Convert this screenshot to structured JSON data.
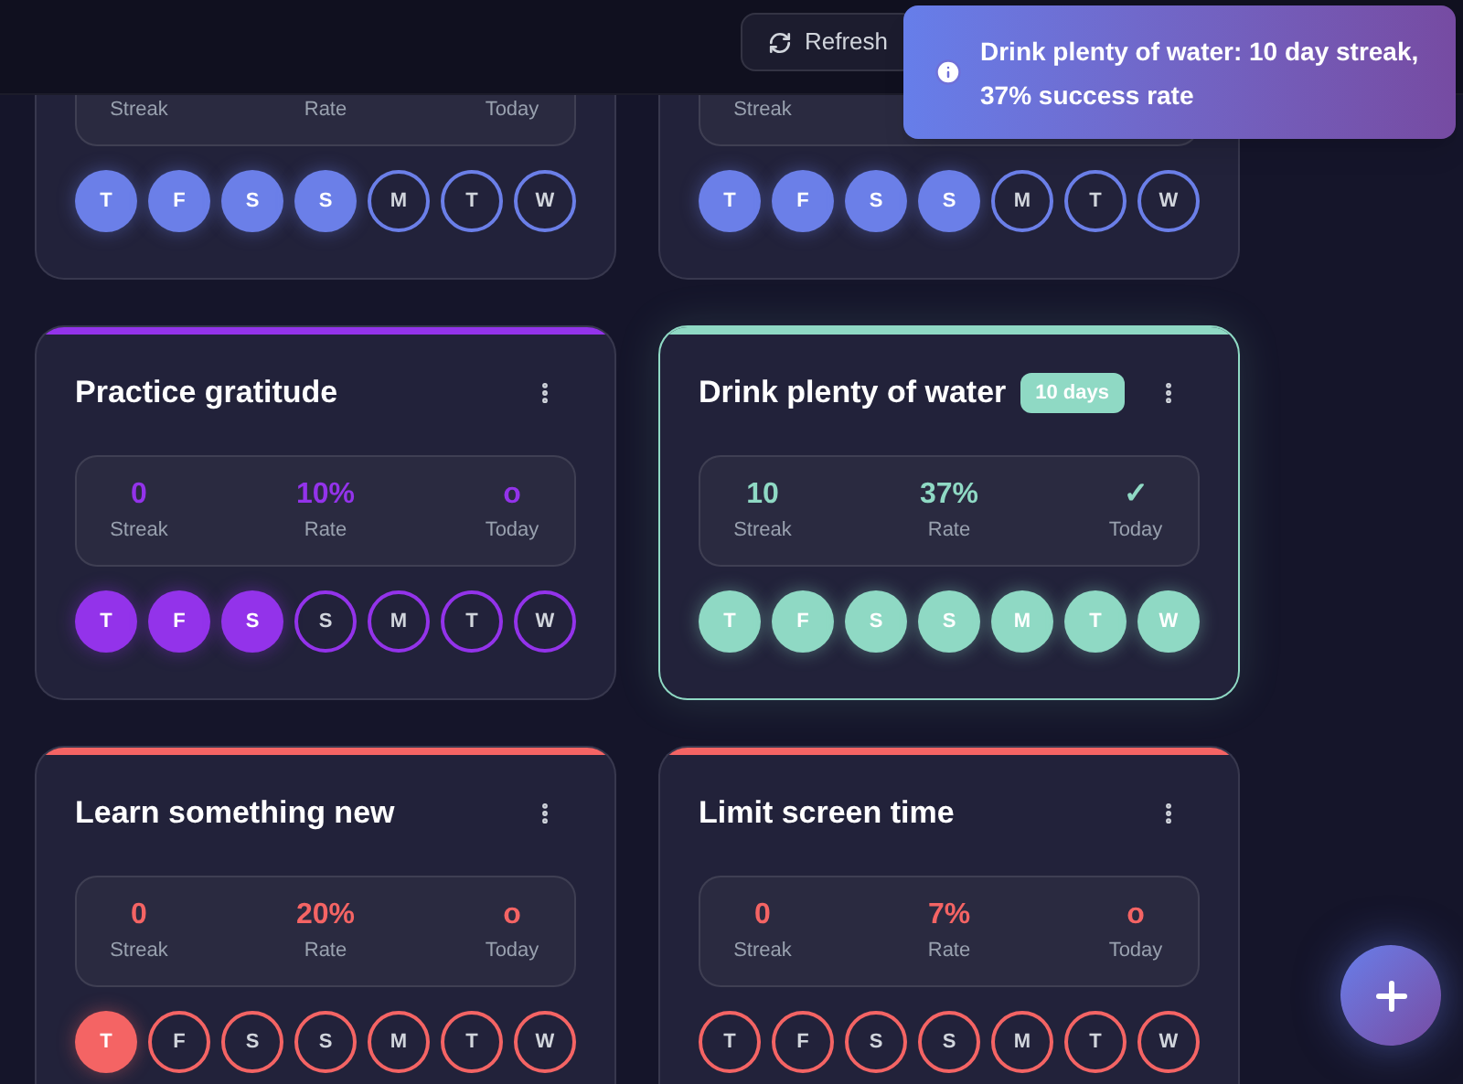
{
  "header": {
    "refresh_button": "Refresh"
  },
  "toast": {
    "message": "Drink plenty of water: 10 day streak, 37% success rate"
  },
  "habits": [
    {
      "color": "#6b7fe8",
      "highlighted": false,
      "stats": [
        {
          "label": "Streak"
        },
        {
          "label": "Rate"
        },
        {
          "label": "Today"
        }
      ],
      "days": [
        {
          "label": "T",
          "done": true
        },
        {
          "label": "F",
          "done": true
        },
        {
          "label": "S",
          "done": true
        },
        {
          "label": "S",
          "done": true
        },
        {
          "label": "M",
          "done": false
        },
        {
          "label": "T",
          "done": false
        },
        {
          "label": "W",
          "done": false
        }
      ]
    },
    {
      "color": "#6b7fe8",
      "highlighted": false,
      "stats": [
        {
          "label": "Streak"
        }
      ],
      "days": [
        {
          "label": "T",
          "done": true
        },
        {
          "label": "F",
          "done": true
        },
        {
          "label": "S",
          "done": true
        },
        {
          "label": "S",
          "done": true
        },
        {
          "label": "M",
          "done": false
        },
        {
          "label": "T",
          "done": false
        },
        {
          "label": "W",
          "done": false
        }
      ]
    },
    {
      "title": "Practice gratitude",
      "color": "#9333ea",
      "highlighted": false,
      "stats": [
        {
          "value": "0",
          "label": "Streak"
        },
        {
          "value": "10%",
          "label": "Rate"
        },
        {
          "value": "o",
          "label": "Today"
        }
      ],
      "days": [
        {
          "label": "T",
          "done": true
        },
        {
          "label": "F",
          "done": true
        },
        {
          "label": "S",
          "done": true
        },
        {
          "label": "S",
          "done": false
        },
        {
          "label": "M",
          "done": false
        },
        {
          "label": "T",
          "done": false
        },
        {
          "label": "W",
          "done": false
        }
      ]
    },
    {
      "title": "Drink plenty of water",
      "badge": "10 days",
      "color": "#8fd9c4",
      "highlighted": true,
      "stats": [
        {
          "value": "10",
          "label": "Streak"
        },
        {
          "value": "37%",
          "label": "Rate"
        },
        {
          "value": "✓",
          "label": "Today"
        }
      ],
      "days": [
        {
          "label": "T",
          "done": true
        },
        {
          "label": "F",
          "done": true
        },
        {
          "label": "S",
          "done": true
        },
        {
          "label": "S",
          "done": true
        },
        {
          "label": "M",
          "done": true
        },
        {
          "label": "T",
          "done": true
        },
        {
          "label": "W",
          "done": true
        }
      ]
    },
    {
      "title": "Learn something new",
      "color": "#f46464",
      "highlighted": false,
      "stats": [
        {
          "value": "0",
          "label": "Streak"
        },
        {
          "value": "20%",
          "label": "Rate"
        },
        {
          "value": "o",
          "label": "Today"
        }
      ],
      "days": [
        {
          "label": "T",
          "done": true
        },
        {
          "label": "F",
          "done": false
        },
        {
          "label": "S",
          "done": false
        },
        {
          "label": "S",
          "done": false
        },
        {
          "label": "M",
          "done": false
        },
        {
          "label": "T",
          "done": false
        },
        {
          "label": "W",
          "done": false
        }
      ]
    },
    {
      "title": "Limit screen time",
      "color": "#f46464",
      "highlighted": false,
      "stats": [
        {
          "value": "0",
          "label": "Streak"
        },
        {
          "value": "7%",
          "label": "Rate"
        },
        {
          "value": "o",
          "label": "Today"
        }
      ],
      "days": [
        {
          "label": "T",
          "done": false
        },
        {
          "label": "F",
          "done": false
        },
        {
          "label": "S",
          "done": false
        },
        {
          "label": "S",
          "done": false
        },
        {
          "label": "M",
          "done": false
        },
        {
          "label": "T",
          "done": false
        },
        {
          "label": "W",
          "done": false
        }
      ]
    }
  ]
}
